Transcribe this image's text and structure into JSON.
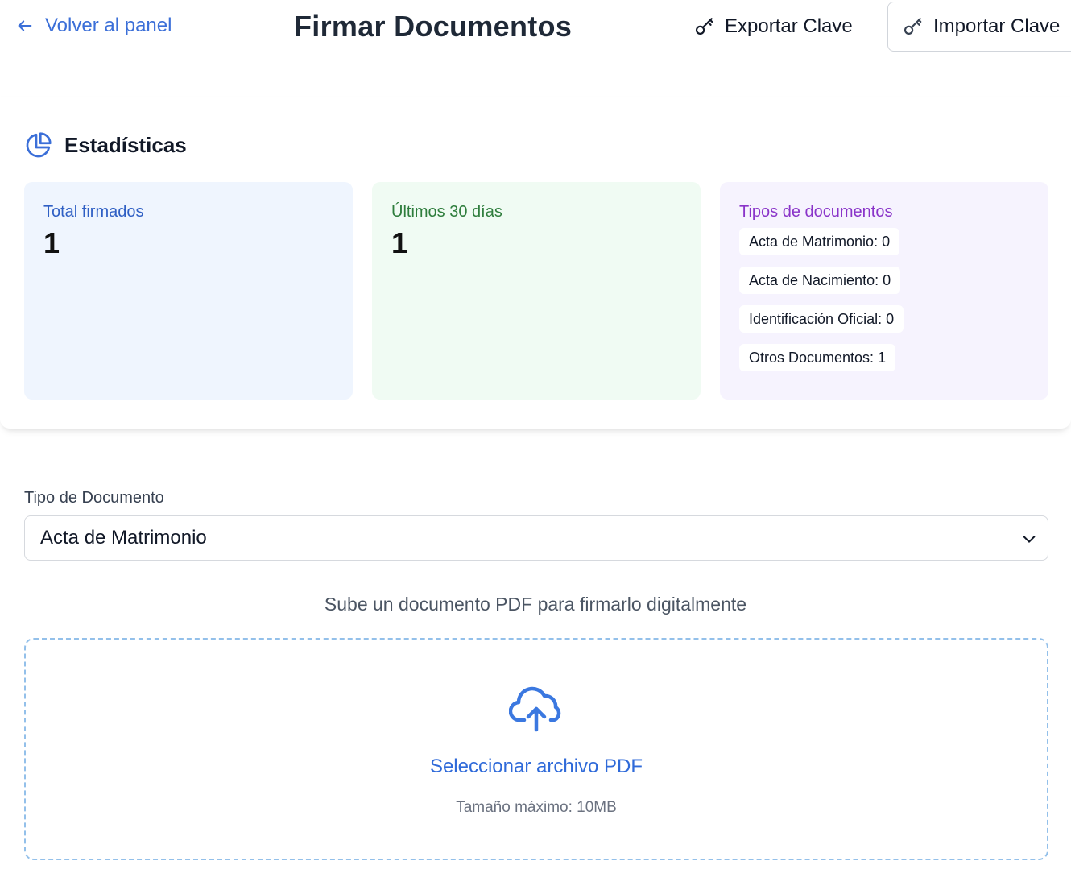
{
  "header": {
    "back_label": "Volver al panel",
    "title": "Firmar Documentos",
    "export_label": "Exportar Clave",
    "import_label": "Importar Clave"
  },
  "stats": {
    "heading": "Estadísticas",
    "total": {
      "label": "Total firmados",
      "value": "1"
    },
    "recent": {
      "label": "Últimos 30 días",
      "value": "1"
    },
    "types": {
      "label": "Tipos de documentos",
      "items": [
        "Acta de Matrimonio: 0",
        "Acta de Nacimiento: 0",
        "Identificación Oficial: 0",
        "Otros Documentos: 1"
      ]
    }
  },
  "form": {
    "doc_type_label": "Tipo de Documento",
    "doc_type_value": "Acta de Matrimonio"
  },
  "upload": {
    "hint": "Sube un documento PDF para firmarlo digitalmente",
    "button_label": "Seleccionar archivo PDF",
    "limit": "Tamaño máximo: 10MB"
  },
  "colors": {
    "accent": "#3b6fd8",
    "card_blue": "#eff5fe",
    "card_green": "#f0fbf3",
    "card_purple": "#f6f3fe",
    "dropzone_border": "#93c0ea"
  },
  "icons": [
    "arrow-left-icon",
    "key-icon",
    "pie-chart-icon",
    "chevron-down-icon",
    "cloud-upload-icon"
  ]
}
